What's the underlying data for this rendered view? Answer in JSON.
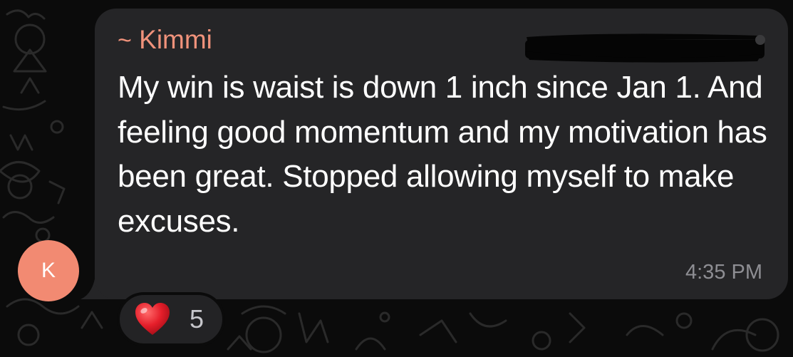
{
  "chat": {
    "avatar": {
      "initial": "K",
      "color": "#f28a72"
    },
    "message": {
      "sender_prefix": "~",
      "sender_name": "Kimmi",
      "sender_color": "#f0927b",
      "text": "My win is waist is down 1 inch since Jan 1. And feeling good momentum and my motivation has been great. Stopped allowing myself to make excuses.",
      "time": "4:35 PM",
      "bubble_color": "#252527"
    },
    "reaction": {
      "emoji_icon": "red-heart-icon",
      "count": "5"
    },
    "background_color": "#0b0b0b"
  }
}
